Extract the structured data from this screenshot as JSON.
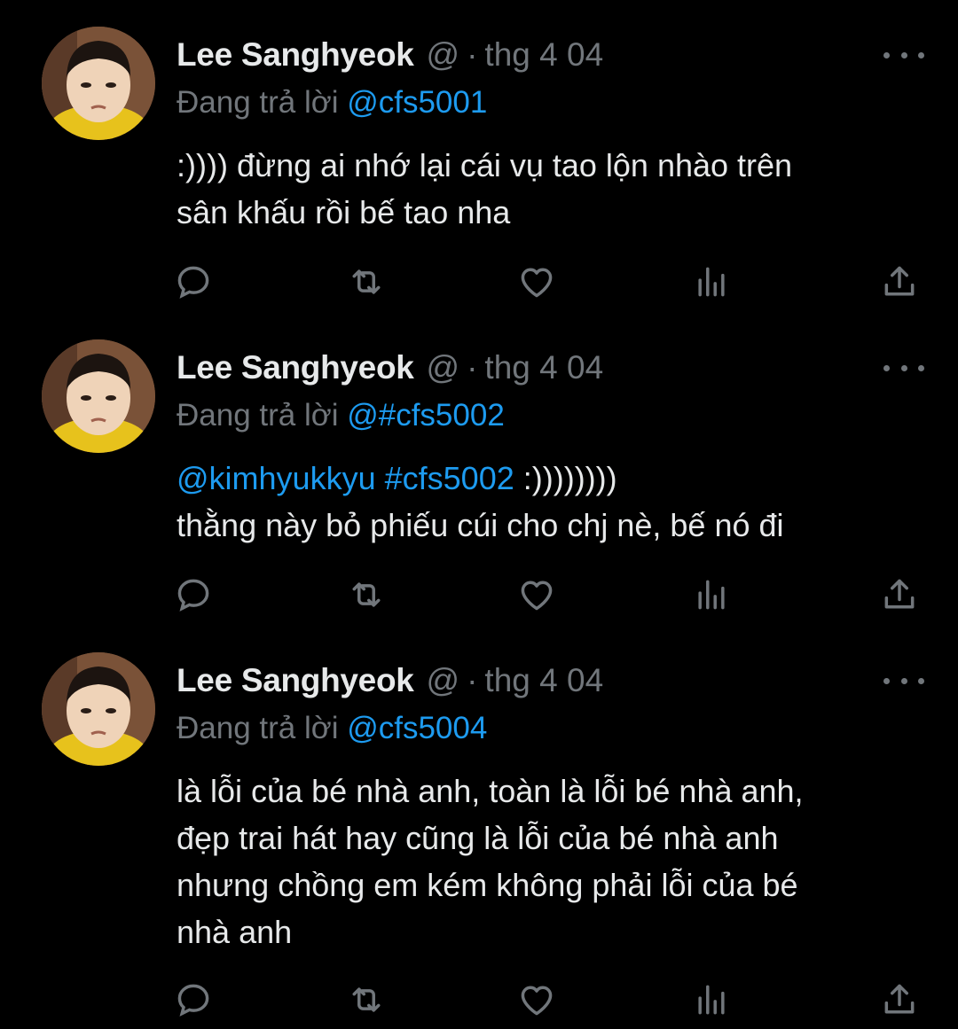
{
  "colors": {
    "background": "#000000",
    "text": "#e7e9ea",
    "muted": "#71767b",
    "link": "#1d9bf0"
  },
  "tweets": [
    {
      "author": "Lee Sanghyeok",
      "handle": "@",
      "separator": "·",
      "time": "thg 4 04",
      "reply_prefix": "Đang trả lời",
      "reply_to": "@cfs5001",
      "body_lines": [
        ":)))) đừng ai nhớ lại cái vụ tao lộn nhào trên",
        "sân khấu rồi bế tao nha"
      ],
      "icons": [
        "reply-icon",
        "retweet-icon",
        "like-icon",
        "views-icon",
        "share-icon"
      ]
    },
    {
      "author": "Lee Sanghyeok",
      "handle": "@",
      "separator": "·",
      "time": "thg 4 04",
      "reply_prefix": "Đang trả lời",
      "reply_to": "@#cfs5002",
      "body_mention": "@kimhyukkyu",
      "body_hashtag": "#cfs5002",
      "body_first_rest": " :))))))))",
      "body_lines": [
        "thằng này bỏ phiếu cúi cho chj nè, bế nó đi"
      ],
      "icons": [
        "reply-icon",
        "retweet-icon",
        "like-icon",
        "views-icon",
        "share-icon"
      ]
    },
    {
      "author": "Lee Sanghyeok",
      "handle": "@",
      "separator": "·",
      "time": "thg 4 04",
      "reply_prefix": "Đang trả lời",
      "reply_to": "@cfs5004",
      "body_lines": [
        "là lỗi của bé nhà anh, toàn là lỗi bé nhà anh,",
        "đẹp trai hát hay cũng là lỗi của bé nhà anh",
        "nhưng chồng em kém không phải lỗi của bé",
        "nhà anh"
      ],
      "icons": [
        "reply-icon",
        "retweet-icon",
        "like-icon",
        "views-icon",
        "share-icon"
      ]
    }
  ]
}
